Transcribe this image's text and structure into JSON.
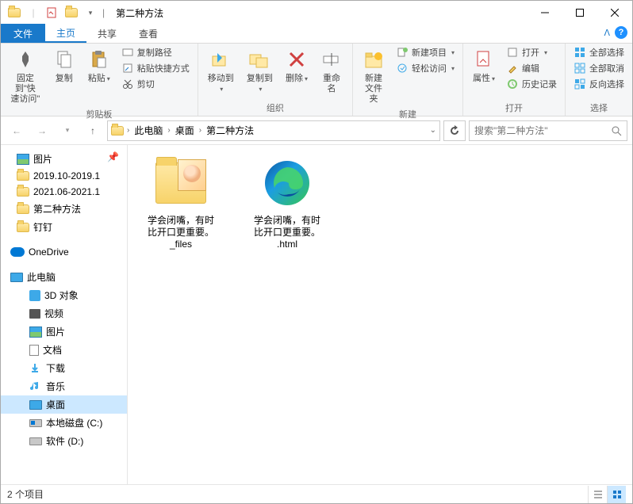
{
  "title_bar": {
    "folder_name": "第二种方法"
  },
  "tabs": {
    "file": "文件",
    "home": "主页",
    "share": "共享",
    "view": "查看"
  },
  "ribbon": {
    "pin": {
      "line1": "固定到\"快",
      "line2": "速访问\""
    },
    "copy": "复制",
    "paste": "粘贴",
    "copy_path": "复制路径",
    "paste_shortcut": "粘贴快捷方式",
    "cut": "剪切",
    "clipboard_group": "剪贴板",
    "move_to": "移动到",
    "copy_to": "复制到",
    "delete": "删除",
    "rename": "重命名",
    "organize_group": "组织",
    "new_folder": {
      "line1": "新建",
      "line2": "文件夹"
    },
    "new_item": "新建项目",
    "easy_access": "轻松访问",
    "new_group": "新建",
    "properties": "属性",
    "open": "打开",
    "edit": "编辑",
    "history": "历史记录",
    "open_group": "打开",
    "select_all": "全部选择",
    "select_none": "全部取消",
    "invert_selection": "反向选择",
    "select_group": "选择"
  },
  "breadcrumbs": {
    "this_pc": "此电脑",
    "desktop": "桌面",
    "current": "第二种方法"
  },
  "search": {
    "placeholder": "搜索\"第二种方法\""
  },
  "tree": {
    "pictures": "图片",
    "folder_2019": "2019.10-2019.1",
    "folder_2021": "2021.06-2021.1",
    "current_folder": "第二种方法",
    "dingding": "钉钉",
    "onedrive": "OneDrive",
    "this_pc": "此电脑",
    "objects_3d": "3D 对象",
    "videos": "视频",
    "pictures2": "图片",
    "documents": "文档",
    "downloads": "下载",
    "music": "音乐",
    "desktop": "桌面",
    "disk_c": "本地磁盘 (C:)",
    "disk_d": "软件 (D:)"
  },
  "files": {
    "item1": {
      "line1": "学会闭嘴，有时",
      "line2": "比开口更重要。",
      "line3": "_files"
    },
    "item2": {
      "line1": "学会闭嘴，有时",
      "line2": "比开口更重要。",
      "line3": ".html"
    }
  },
  "status": {
    "count": "2 个项目"
  }
}
